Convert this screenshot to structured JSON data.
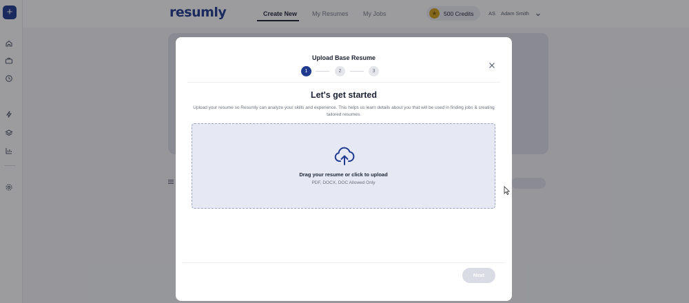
{
  "sidebar": {
    "add_label": "+",
    "icons": [
      "home-icon",
      "briefcase-icon",
      "clock-icon",
      "bolt-icon",
      "layers-icon",
      "chart-icon",
      "settings-icon"
    ]
  },
  "header": {
    "logo": "resumly",
    "tabs": [
      {
        "label": "Create New",
        "active": true
      },
      {
        "label": "My Resumes",
        "active": false
      },
      {
        "label": "My Jobs",
        "active": false
      }
    ],
    "credits": "500 Credits",
    "user": {
      "initials": "AS",
      "name": "Adam Smith"
    }
  },
  "modal": {
    "title": "Upload Base Resume",
    "steps": [
      "1",
      "2",
      "3"
    ],
    "current_step": 1,
    "heading": "Let's get started",
    "description": "Upload your resume so Resumly can analyze your skills and experience. This helps us learn details about you that will be used in finding jobs & creating tailored resumes.",
    "dropzone": {
      "title": "Drag your resume or click to upload",
      "subtitle": "PDF, DOCX, DOC Allowed Only"
    },
    "next_label": "Next"
  },
  "colors": {
    "brand": "#1f3a8f",
    "dropzone_bg": "#e6e9f3",
    "disabled_button": "#d9dce5"
  }
}
